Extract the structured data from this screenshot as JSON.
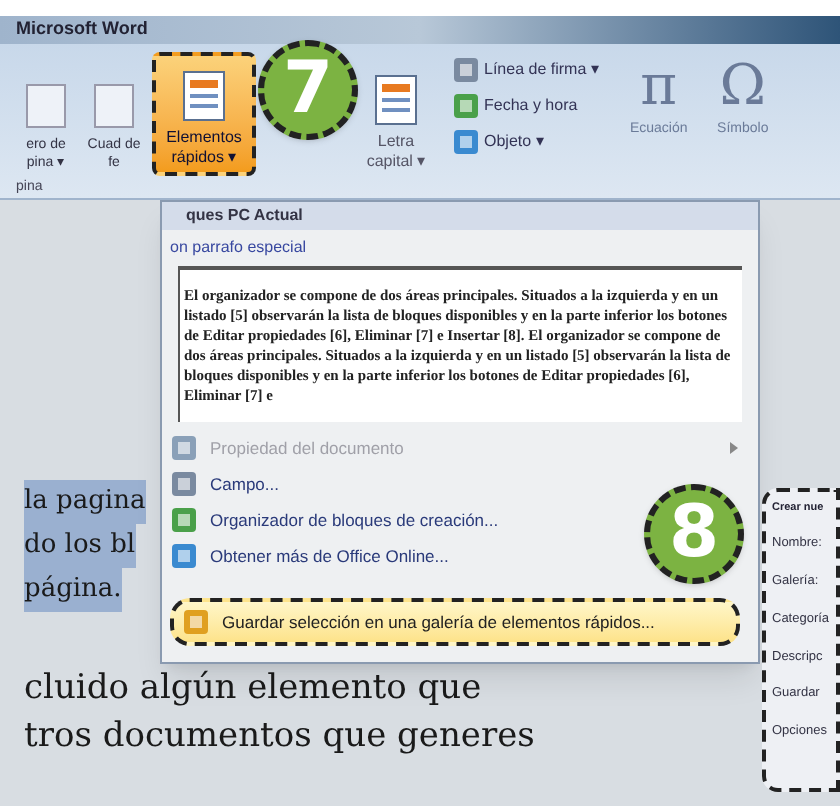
{
  "window": {
    "title": "Microsoft Word"
  },
  "ribbon": {
    "items": [
      {
        "kind": "cut",
        "label": "ero de pina ▾"
      },
      {
        "kind": "cut",
        "label": "Cuad de fe"
      },
      {
        "kind": "large",
        "label": "Elementos rápidos",
        "caret": "▾",
        "selected": true
      },
      {
        "kind": "large",
        "label": "Letra capital ▾",
        "selected": false
      }
    ],
    "small_buttons": [
      "Línea de firma ▾",
      "Fecha y hora",
      "Objeto ▾"
    ],
    "symbols": [
      {
        "glyph": "π",
        "label": "Ecuación"
      },
      {
        "glyph": "Ω",
        "label": "Símbolo"
      }
    ],
    "group_label": "pina"
  },
  "document": {
    "selected_lines": [
      "la pagina",
      "do los bl",
      "página."
    ],
    "lines": [
      "cluido algún elemento que",
      "tros documentos que generes"
    ]
  },
  "menu": {
    "header": "ques PC Actual",
    "preview_title": "on parrafo especial",
    "preview_text": "El organizador se compone de dos áreas principales. Situados a la izquierda y en un listado [5] observarán la lista de bloques disponibles y en la parte inferior los botones de Editar propiedades [6], Eliminar [7] e Insertar [8]. El organizador se compone de dos áreas principales. Situados a la izquierda y en un listado [5] observarán la lista de bloques disponibles y en la parte inferior los botones de Editar propiedades [6], Eliminar [7] e",
    "items": [
      {
        "label": "Propiedad del documento",
        "disabled": true,
        "submenu": true,
        "selected": false
      },
      {
        "label": "Campo...",
        "disabled": false,
        "submenu": false,
        "selected": false
      },
      {
        "label": "Organizador de bloques de creación...",
        "disabled": false,
        "submenu": false,
        "selected": false
      },
      {
        "label": "Obtener más de Office Online...",
        "disabled": false,
        "submenu": false,
        "selected": false
      },
      {
        "label": "Guardar selección en una galería de elementos rápidos...",
        "disabled": false,
        "submenu": false,
        "selected": true
      }
    ]
  },
  "dialog": {
    "title": "Crear nue",
    "labels": [
      "Nombre:",
      "Galería:",
      "Categoría",
      "Descripc",
      "Guardar",
      "Opciones"
    ]
  },
  "callouts": [
    "7",
    "8"
  ]
}
